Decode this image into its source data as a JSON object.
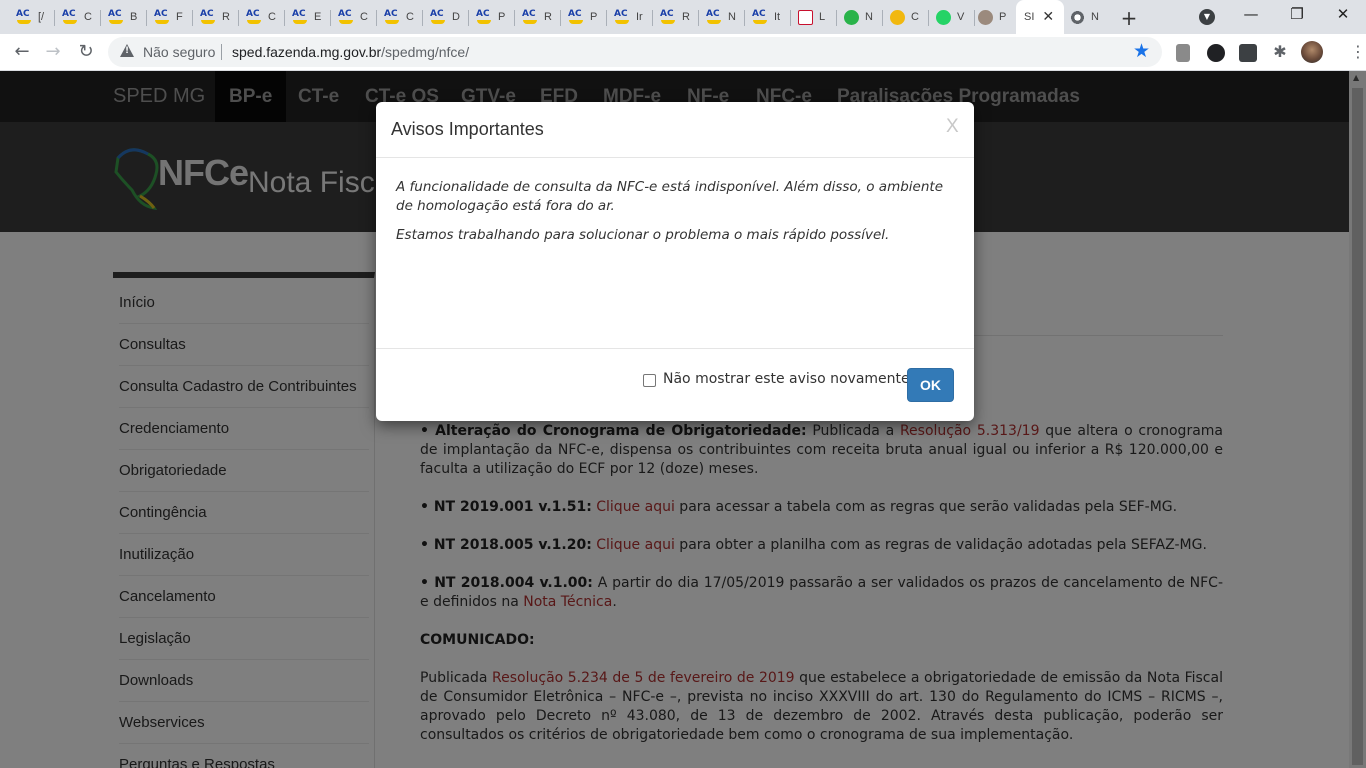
{
  "browser": {
    "tabs": [
      {
        "icon": "ac-icon",
        "label": "[/"
      },
      {
        "icon": "ac-icon",
        "label": "C"
      },
      {
        "icon": "ac-icon",
        "label": "B"
      },
      {
        "icon": "ac-icon",
        "label": "F"
      },
      {
        "icon": "ac-icon",
        "label": "R"
      },
      {
        "icon": "ac-icon",
        "label": "C"
      },
      {
        "icon": "ac-icon",
        "label": "E"
      },
      {
        "icon": "ac-icon",
        "label": "C"
      },
      {
        "icon": "ac-icon",
        "label": "C"
      },
      {
        "icon": "ac-icon",
        "label": "D"
      },
      {
        "icon": "ac-icon",
        "label": "P"
      },
      {
        "icon": "ac-icon",
        "label": "R"
      },
      {
        "icon": "ac-icon",
        "label": "P"
      },
      {
        "icon": "ac-icon",
        "label": "Ir"
      },
      {
        "icon": "ac-icon",
        "label": "R"
      },
      {
        "icon": "ac-icon",
        "label": "N"
      },
      {
        "icon": "ac-icon",
        "label": "It"
      },
      {
        "icon": "w-icon",
        "label": "L"
      },
      {
        "icon": "n-icon",
        "label": "N"
      },
      {
        "icon": "coin-icon",
        "label": "C"
      },
      {
        "icon": "whatsapp-icon",
        "label": "V"
      },
      {
        "icon": "person-icon",
        "label": "P"
      }
    ],
    "active_tab": {
      "label": "SI",
      "close": "✕"
    },
    "last_tab": {
      "label": "N"
    },
    "new_tab": "+",
    "window_controls": {
      "minimize": "—",
      "maximize": "❐",
      "close": "✕"
    },
    "not_secure": "Não seguro",
    "url_host": "sped.fazenda.mg.gov.br",
    "url_path": "/spedmg/nfce/"
  },
  "site_nav": {
    "brand": "SPED MG",
    "items": [
      "BP-e",
      "CT-e",
      "CT-e OS",
      "GTV-e",
      "EFD",
      "MDF-e",
      "NF-e",
      "NFC-e",
      "Paralisações Programadas"
    ]
  },
  "header": {
    "logo_text": "NFCe",
    "title": "Nota Fiscal de Consumidor Eletrônica"
  },
  "sidebar": {
    "items": [
      "Início",
      "Consultas",
      "Consulta Cadastro de Contribuintes",
      "Credenciamento",
      "Obrigatoriedade",
      "Contingência",
      "Inutilização",
      "Cancelamento",
      "Legislação",
      "Downloads",
      "Webservices",
      "Perguntas e Respostas"
    ]
  },
  "content": {
    "p1": {
      "bold": "• Alteração do Cronograma de Obrigatoriedade:",
      "t1": " Publicada a ",
      "link": "Resolução 5.313/19",
      "t2": " que altera o cronograma de implantação da NFC-e, dispensa os contribuintes com receita bruta anual igual ou inferior a R$ 120.000,00 e faculta a utilização do ECF por 12 (doze) meses."
    },
    "p2": {
      "bold": "• NT 2019.001 v.1.51:",
      "link": " Clique aqui",
      "t1": " para acessar a tabela com as regras que serão validadas pela SEF-MG."
    },
    "p3": {
      "bold": "• NT 2018.005 v.1.20:",
      "link": " Clique aqui",
      "t1": " para obter a planilha com as regras de validação adotadas pela SEFAZ-MG."
    },
    "p4": {
      "bold": "• NT 2018.004 v.1.00:",
      "t1": " A partir do dia 17/05/2019 passarão a ser validados os prazos de cancelamento de NFC-e definidos na ",
      "link": "Nota Técnica",
      "t2": "."
    },
    "comunicado": "COMUNICADO:",
    "p5": {
      "t1": "Publicada ",
      "link": "Resolução 5.234 de 5 de fevereiro de 2019",
      "t2": " que estabelece a obrigatoriedade de emissão da Nota Fiscal de Consumidor Eletrônica – NFC-e –, prevista no inciso XXXVIII do art. 130 do Regulamento do ICMS – RICMS –, aprovado pelo Decreto nº 43.080, de 13 de dezembro de 2002. Através desta publicação, poderão ser consultados os critérios de obrigatoriedade bem como o cronograma de sua implementação."
    }
  },
  "modal": {
    "title": "Avisos Importantes",
    "close": "X",
    "message1": "A funcionalidade de consulta da NFC-e está indisponível. Além disso, o ambiente de homologação está fora do ar.",
    "message2": "Estamos trabalhando para solucionar o problema o mais rápido possível.",
    "checkbox_label": "Não mostrar este aviso novamente",
    "ok_label": "OK"
  }
}
